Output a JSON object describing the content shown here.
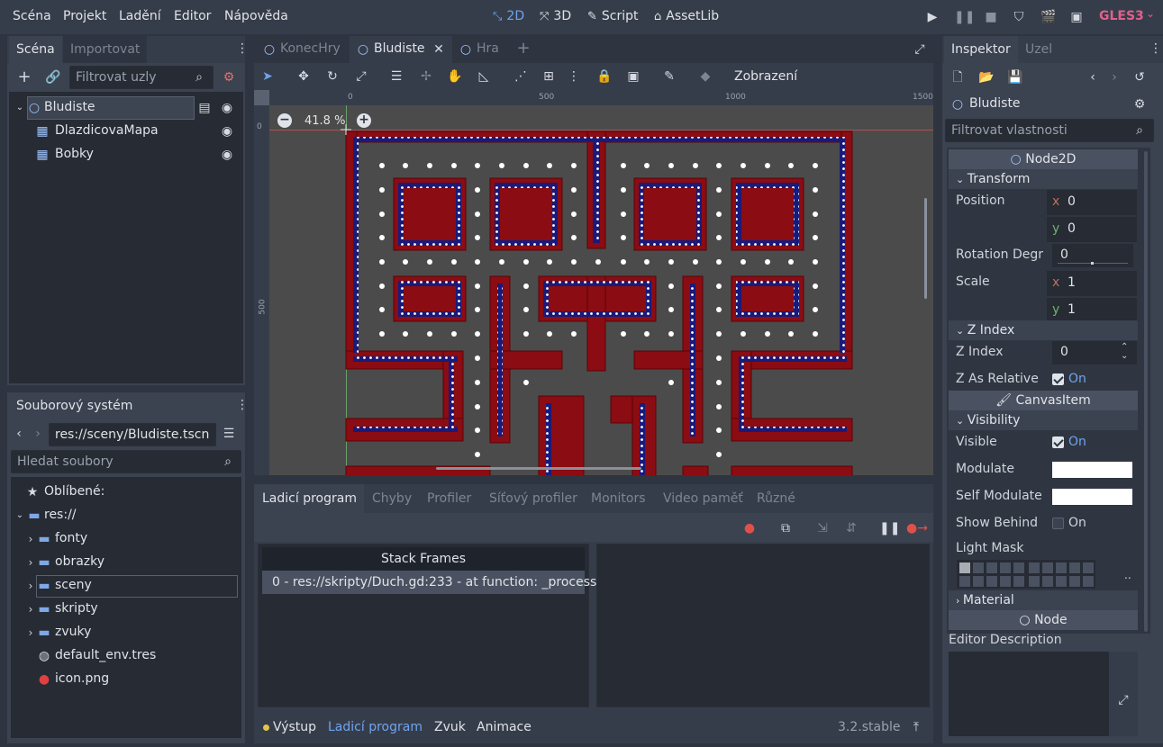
{
  "menu": {
    "items": [
      "Scéna",
      "Projekt",
      "Ladění",
      "Editor",
      "Nápověda"
    ],
    "workspaces": [
      "2D",
      "3D",
      "Script",
      "AssetLib"
    ],
    "renderer": "GLES3"
  },
  "scene_dock": {
    "tabs": [
      "Scéna",
      "Importovat"
    ],
    "filter_placeholder": "Filtrovat uzly",
    "nodes": [
      {
        "name": "Bludiste",
        "icon": "node2d-icon",
        "level": 0
      },
      {
        "name": "DlazdicovaMapa",
        "icon": "tilemap-icon",
        "level": 1
      },
      {
        "name": "Bobky",
        "icon": "tilemap-icon",
        "level": 1
      }
    ]
  },
  "filesystem": {
    "tab": "Souborový systém",
    "path": "res://sceny/Bludiste.tscn",
    "search_placeholder": "Hledat soubory",
    "favorites": "Oblíbené:",
    "root": "res://",
    "folders": [
      "fonty",
      "obrazky",
      "sceny",
      "skripty",
      "zvuky"
    ],
    "files": [
      "default_env.tres",
      "icon.png"
    ]
  },
  "scene_tabs": [
    "KonecHry",
    "Bludiste",
    "Hra"
  ],
  "viewport": {
    "toolbar_view": "Zobrazení",
    "zoom": "41.8 %",
    "ruler_top": [
      "0",
      "500",
      "1000",
      "1500"
    ],
    "ruler_left": [
      "0",
      "500"
    ]
  },
  "debugger": {
    "tabs": [
      "Ladicí program",
      "Chyby",
      "Profiler",
      "Síťový profiler",
      "Monitors",
      "Video paměť",
      "Různé"
    ],
    "stack_header": "Stack Frames",
    "stack_frame": "0 - res://skripty/Duch.gd:233 - at function: _process"
  },
  "bottom_bar": {
    "tabs": [
      "Výstup",
      "Ladicí program",
      "Zvuk",
      "Animace"
    ],
    "version": "3.2.stable"
  },
  "inspector": {
    "tabs": [
      "Inspektor",
      "Uzel"
    ],
    "node_name": "Bludiste",
    "filter_placeholder": "Filtrovat vlastnosti",
    "class_header": "Node2D",
    "transform": {
      "title": "Transform",
      "position_label": "Position",
      "position_x": "0",
      "position_y": "0",
      "rotation_label": "Rotation Degr",
      "rotation_value": "0",
      "scale_label": "Scale",
      "scale_x": "1",
      "scale_y": "1"
    },
    "zindex": {
      "title": "Z Index",
      "zindex_label": "Z Index",
      "zindex_value": "0",
      "relative_label": "Z As Relative",
      "relative_value": "On"
    },
    "canvas_item": "CanvasItem",
    "visibility": {
      "title": "Visibility",
      "visible_label": "Visible",
      "visible_value": "On",
      "modulate_label": "Modulate",
      "self_modulate_label": "Self Modulate",
      "show_behind_label": "Show Behind",
      "show_behind_value": "On",
      "light_mask_label": "Light Mask"
    },
    "material": "Material",
    "node_header": "Node",
    "editor_description": "Editor Description"
  }
}
